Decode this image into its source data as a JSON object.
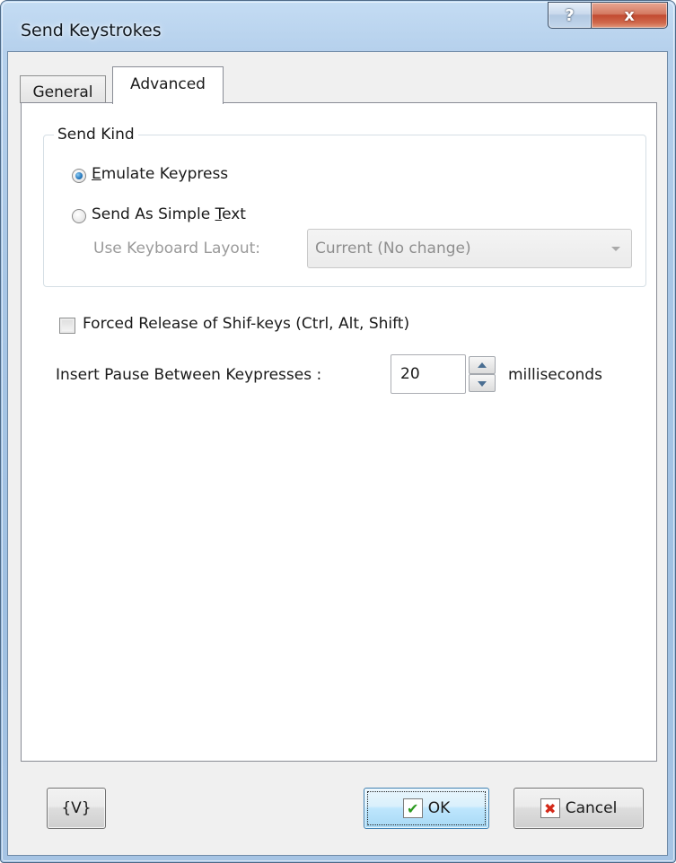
{
  "window": {
    "title": "Send Keystrokes",
    "help_glyph": "?",
    "close_glyph": "x"
  },
  "tabs": [
    {
      "label": "General",
      "selected": false
    },
    {
      "label": "Advanced",
      "selected": true
    }
  ],
  "send_kind": {
    "group_label": "Send Kind",
    "options": [
      {
        "label_mnemonic": "E",
        "label_rest": "mulate Keypress",
        "checked": true
      },
      {
        "label_before": "Send As Simple ",
        "label_mnemonic": "T",
        "label_after": "ext",
        "checked": false
      }
    ],
    "keyboard_layout": {
      "label": "Use Keyboard Layout:",
      "value": "Current (No change)",
      "enabled": false
    }
  },
  "forced_release": {
    "label": "Forced Release of Shif-keys (Ctrl, Alt, Shift)",
    "checked": false
  },
  "pause": {
    "label": "Insert Pause Between Keypresses :",
    "value": "20",
    "unit": "milliseconds"
  },
  "buttons": {
    "variables": "{V}",
    "ok": "OK",
    "ok_icon": "✔",
    "cancel": "Cancel",
    "cancel_icon": "✖"
  },
  "colors": {
    "frame": "#a9c7e6",
    "close_button": "#c24a30",
    "ok_icon": "#2c9a1f",
    "cancel_icon": "#d42a1a"
  }
}
